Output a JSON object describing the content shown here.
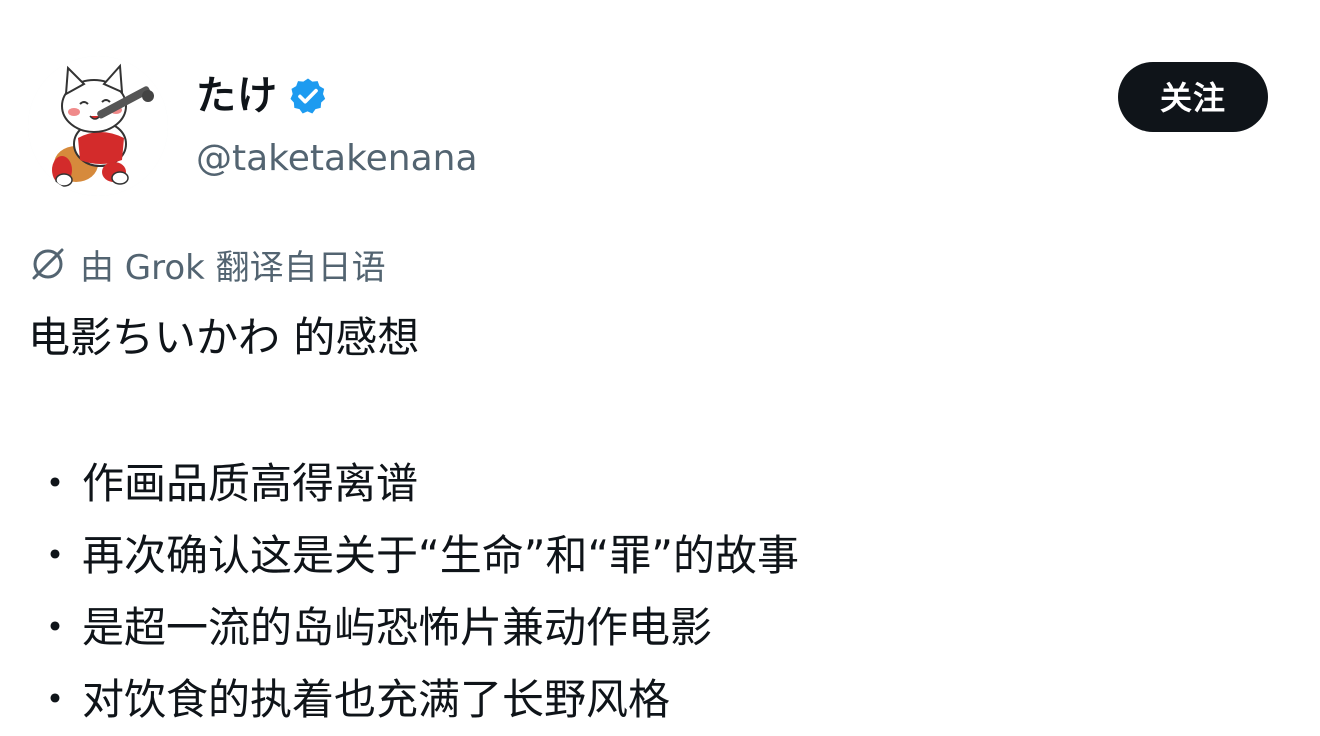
{
  "author": {
    "display_name": "たけ",
    "handle": "@taketakenana",
    "verified": true,
    "verified_color": "#1d9bf0"
  },
  "follow_button": {
    "label": "关注",
    "bg_color": "#0f1419"
  },
  "translation": {
    "icon": "grok-icon",
    "label": "由 Grok 翻译自日语"
  },
  "tweet": {
    "title": "电影ちいかわ 的感想",
    "bullet_symbol": "・",
    "bullets": [
      "作画品质高得离谱",
      "再次确认这是关于“生命”和“罪”的故事",
      "是超一流的岛屿恐怖片兼动作电影",
      "对饮食的执着也充满了长野风格"
    ]
  }
}
